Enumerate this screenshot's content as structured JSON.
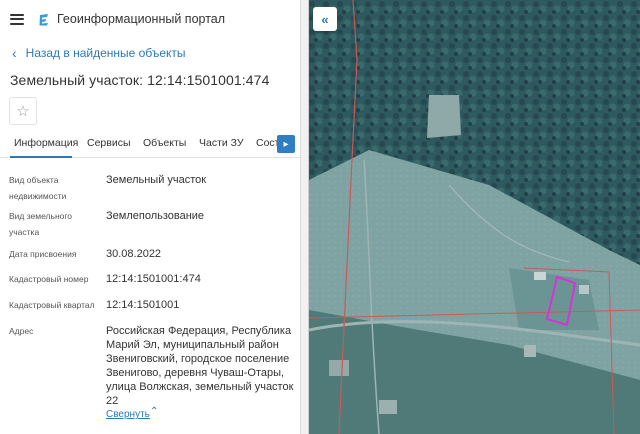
{
  "header": {
    "title": "Геоинформационный портал"
  },
  "nav": {
    "back_label": "Назад в найденные объекты"
  },
  "object": {
    "title": "Земельный участок: 12:14:1501001:474"
  },
  "tabs": [
    {
      "label": "Информация",
      "active": true
    },
    {
      "label": "Сервисы"
    },
    {
      "label": "Объекты"
    },
    {
      "label": "Части ЗУ"
    },
    {
      "label": "Соста"
    }
  ],
  "details": {
    "type": {
      "label_line1": "Вид объекта",
      "label_line2": "недвижимости",
      "value": "Земельный участок"
    },
    "land_use": {
      "label_line1": "Вид земельного",
      "label_line2": "участка",
      "value": "Землепользование"
    },
    "date": {
      "label": "Дата присвоения",
      "value": "30.08.2022"
    },
    "cad_number": {
      "label": "Кадастровый номер",
      "value": "12:14:1501001:474"
    },
    "cad_block": {
      "label": "Кадастровый квартал",
      "value": "12:14:1501001"
    },
    "address": {
      "label": "Адрес",
      "line1": "Российская Федерация, Республика",
      "line2": "Марий Эл, муниципальный район",
      "line3": "Звениговский, городское поселение",
      "line4": "Звенигово, деревня Чуваш-Отары,",
      "line5": "улица Волжская, земельный участок",
      "line6": "22"
    }
  },
  "collapse_label": "Свернуть",
  "icons": {
    "menu": "hamburger-icon",
    "logo": "portal-logo-icon",
    "back": "chevron-left-icon",
    "favorite": "star-icon",
    "tabs_next": "chevron-right-icon",
    "collapse": "chevron-up-icon",
    "map_toggle": "double-chevron-left-icon"
  },
  "colors": {
    "accent": "#2a7ab8",
    "parcel_highlight": "#d633d6",
    "cadastral_lines": "#c85a5a"
  }
}
